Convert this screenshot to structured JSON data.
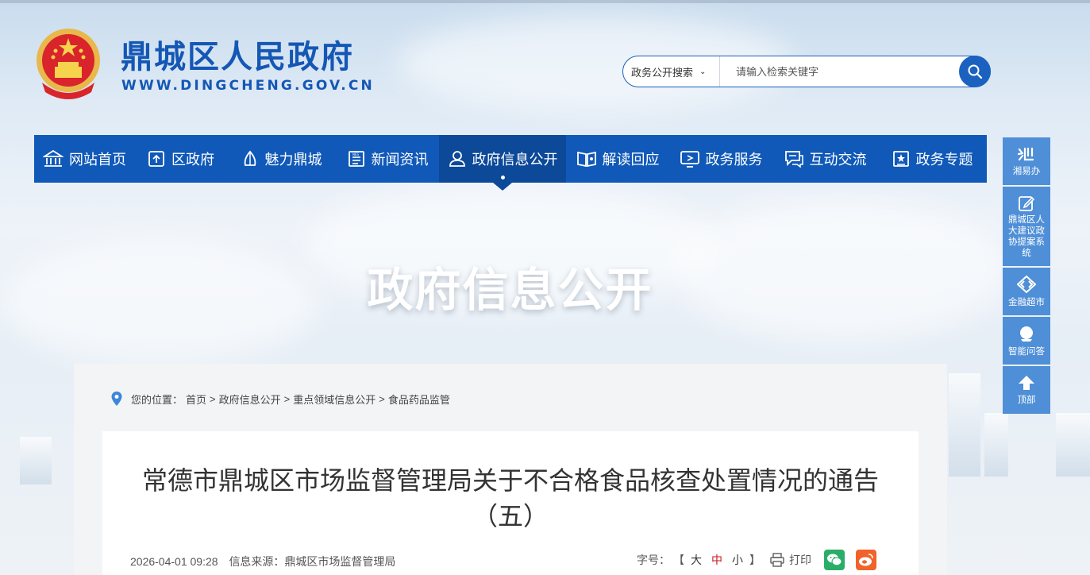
{
  "header": {
    "site_title": "鼎城区人民政府",
    "site_domain": "WWW.DINGCHENG.GOV.CN"
  },
  "search": {
    "scope": "政务公开搜索",
    "placeholder": "请输入检索关键字"
  },
  "nav": {
    "items": [
      {
        "label": "网站首页",
        "icon": "bank-icon"
      },
      {
        "label": "区政府",
        "icon": "building-icon"
      },
      {
        "label": "魅力鼎城",
        "icon": "sail-icon"
      },
      {
        "label": "新闻资讯",
        "icon": "news-icon"
      },
      {
        "label": "政府信息公开",
        "icon": "person-icon",
        "active": true
      },
      {
        "label": "解读回应",
        "icon": "book-icon"
      },
      {
        "label": "政务服务",
        "icon": "monitor-icon"
      },
      {
        "label": "互动交流",
        "icon": "chat-icon"
      },
      {
        "label": "政务专题",
        "icon": "badge-icon"
      }
    ]
  },
  "banner": {
    "title": "政府信息公开"
  },
  "sidebar": {
    "items": [
      {
        "label": "湘易办",
        "icon": "xiang-icon"
      },
      {
        "label": "鼎城区人大建议政协提案系统",
        "icon": "edit-icon"
      },
      {
        "label": "金融超市",
        "icon": "diamond-icon"
      },
      {
        "label": "智能问答",
        "icon": "robot-icon"
      },
      {
        "label": "顶部",
        "icon": "arrow-up-icon"
      }
    ]
  },
  "breadcrumb": {
    "prefix": "您的位置：",
    "items": [
      "首页",
      "政府信息公开",
      "重点领域信息公开",
      "食品药品监管"
    ],
    "sep": ">"
  },
  "article": {
    "title_line1": "常德市鼎城区市场监督管理局关于不合格食品核查处置情况的通告",
    "title_line2": "（五）",
    "date": "2026-04-01 09:28",
    "source": "信息来源：鼎城区市场监督管理局",
    "font_label": "字号：",
    "bracket_open": "【",
    "bracket_close": "】",
    "size_large": "大",
    "size_medium": "中",
    "size_small": "小",
    "print": "打印"
  },
  "colors": {
    "brand": "#1059b8",
    "nav_active": "#0c4999",
    "side": "#4f8fd7",
    "wechat": "#2aae67",
    "weibo": "#f0632b"
  }
}
